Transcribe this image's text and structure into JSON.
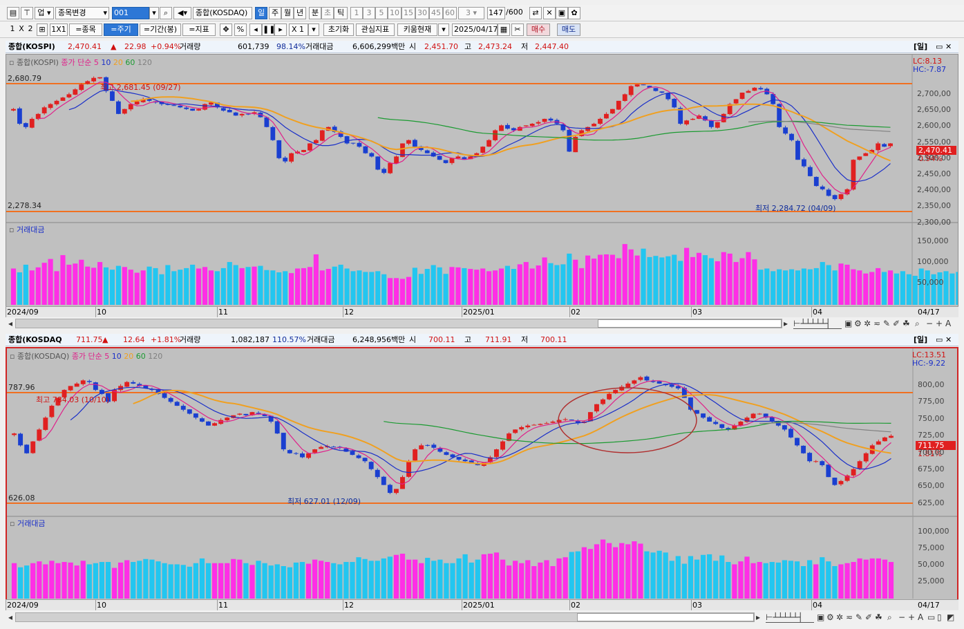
{
  "toolbar1": {
    "market_select": "업",
    "change_symbol": "종목변경",
    "code": "001",
    "symbol_name": "종합(KOSDAQ)",
    "periods": [
      "일",
      "주",
      "월",
      "년",
      "분",
      "초",
      "틱"
    ],
    "selected_period": "일",
    "intervals": [
      "1",
      "3",
      "5",
      "10",
      "15",
      "30",
      "45",
      "60"
    ],
    "count_select": "3",
    "record_count": "147",
    "record_total": "/600"
  },
  "toolbar2": {
    "layout_1": "1",
    "layout_x": "X",
    "layout_2": "2",
    "grid_label": "1X1",
    "btn_symbol": "=종목",
    "btn_period": "=주기",
    "btn_range": "=기간(봉)",
    "btn_indicator": "=지표",
    "pct": "%",
    "mult": "X 1",
    "reset": "초기화",
    "fav": "관심지표",
    "kiwoom": "키움현재",
    "date": "2025/04/17",
    "buy": "매수",
    "sell": "매도"
  },
  "pane1": {
    "info": {
      "name": "종합(KOSPI)",
      "price": "2,470.41",
      "arrow": "▲",
      "change": "22.98",
      "pct": "+0.94%",
      "vol_label": "거래량",
      "vol": "601,739",
      "vol_pct": "98.14%",
      "amt_label": "거래대금",
      "amt": "6,606,299백만",
      "open_label": "시",
      "open": "2,451.70",
      "high_label": "고",
      "high": "2,473.24",
      "low_label": "저",
      "low": "2,447.40"
    },
    "period_tag": "[일]",
    "legend": {
      "name": "종합(KOSPI)",
      "ma_label": "종가 단순",
      "ma5": "5",
      "ma10": "10",
      "ma20": "20",
      "ma60": "60",
      "ma120": "120"
    },
    "lc": "LC:8.13",
    "hc": "HC:-7.87",
    "hi_line": "2,680.79",
    "lo_line": "2,278.34",
    "hi_note": "최고 2,681.45 (09/27)",
    "lo_note": "최저 2,284.72 (04/09)",
    "price_badge": "2,470.41",
    "pct_badge": "0.94%",
    "y_ticks": [
      "2,700,00",
      "2,650,00",
      "2,600,00",
      "2,550,00",
      "2,500,00",
      "2,450,00",
      "2,400,00",
      "2,350,00",
      "2,300,00"
    ],
    "vol_title": "거래대금",
    "vol_ticks": [
      "150,000",
      "100,000",
      "50,000"
    ],
    "dates": [
      "2024/09",
      "10",
      "11",
      "12",
      "2025/01",
      "02",
      "03",
      "04"
    ],
    "last_date": "04/17"
  },
  "pane2": {
    "info": {
      "name": "종합(KOSDAQ",
      "price": "711.75",
      "arrow": "▲",
      "change": "12.64",
      "pct": "+1.81%",
      "vol_label": "거래량",
      "vol": "1,082,187",
      "vol_pct": "110.57%",
      "amt_label": "거래대금",
      "amt": "6,248,956백만",
      "open_label": "시",
      "open": "700.11",
      "high_label": "고",
      "high": "711.91",
      "low_label": "저",
      "low": "700.11"
    },
    "period_tag": "[일]",
    "legend": {
      "name": "종합(KOSDAQ)",
      "ma_label": "종가 단순",
      "ma5": "5",
      "ma10": "10",
      "ma20": "20",
      "ma60": "60",
      "ma120": "120"
    },
    "lc": "LC:13.51",
    "hc": "HC:-9.22",
    "hi_line": "787.96",
    "lo_line": "626.08",
    "hi_note": "최고 784.03 (10/10)",
    "lo_note": "최저 627.01 (12/09)",
    "price_badge": "711.75",
    "pct_badge": "1.81%",
    "y_ticks": [
      "800,00",
      "775,00",
      "750,00",
      "725,00",
      "700,00",
      "675,00",
      "650,00",
      "625,00"
    ],
    "vol_title": "거래대금",
    "vol_ticks": [
      "100,000",
      "75,000",
      "50,000",
      "25,000"
    ],
    "dates": [
      "2024/09",
      "10",
      "11",
      "12",
      "2025/01",
      "02",
      "03",
      "04"
    ],
    "last_date": "04/17"
  },
  "colors": {
    "up": "#e02020",
    "down": "#1a3fd0",
    "vol_up": "#ff2ee6",
    "vol_down": "#22c6f0",
    "ma5": "#e0208a",
    "ma10": "#1a2fc8",
    "ma20": "#f0a020",
    "ma60": "#1a9a30",
    "ma120": "#808080",
    "hline": "#f07020"
  },
  "chart_data": [
    {
      "type": "candlestick",
      "title": "종합(KOSPI)",
      "y_range": [
        2260,
        2720
      ],
      "close": [
        2575,
        2530,
        2520,
        2545,
        2560,
        2580,
        2590,
        2600,
        2610,
        2620,
        2635,
        2650,
        2660,
        2670,
        2672,
        2630,
        2600,
        2560,
        2575,
        2590,
        2598,
        2605,
        2600,
        2595,
        2590,
        2588,
        2585,
        2580,
        2575,
        2570,
        2575,
        2590,
        2595,
        2580,
        2570,
        2565,
        2555,
        2560,
        2560,
        2565,
        2550,
        2520,
        2480,
        2425,
        2415,
        2440,
        2445,
        2450,
        2470,
        2480,
        2510,
        2520,
        2505,
        2490,
        2470,
        2470,
        2460,
        2440,
        2430,
        2390,
        2380,
        2410,
        2430,
        2470,
        2480,
        2460,
        2450,
        2440,
        2430,
        2420,
        2410,
        2425,
        2430,
        2420,
        2430,
        2440,
        2460,
        2480,
        2510,
        2525,
        2515,
        2510,
        2520,
        2525,
        2530,
        2535,
        2545,
        2540,
        2530,
        2510,
        2445,
        2490,
        2510,
        2520,
        2530,
        2545,
        2560,
        2575,
        2600,
        2620,
        2645,
        2650,
        2648,
        2640,
        2630,
        2625,
        2605,
        2580,
        2530,
        2540,
        2545,
        2555,
        2540,
        2520,
        2535,
        2560,
        2590,
        2605,
        2625,
        2630,
        2640,
        2635,
        2620,
        2590,
        2520,
        2500,
        2480,
        2420,
        2400,
        2370,
        2340,
        2330,
        2310,
        2300,
        2315,
        2330,
        2420,
        2430,
        2440,
        2450,
        2470,
        2460,
        2470
      ],
      "volume": [
        95,
        85,
        105,
        90,
        98,
        110,
        120,
        88,
        130,
        105,
        108,
        118,
        100,
        97,
        112,
        98,
        92,
        102,
        99,
        92,
        84,
        90,
        100,
        96,
        80,
        104,
        88,
        92,
        96,
        105,
        95,
        99,
        90,
        88,
        96,
        112,
        104,
        96,
        99,
        100,
        102,
        91,
        90,
        85,
        88,
        83,
        95,
        96,
        99,
        132,
        90,
        94,
        100,
        105,
        95,
        88,
        90,
        86,
        86,
        88,
        80,
        70,
        70,
        68,
        73,
        97,
        81,
        94,
        104,
        98,
        81,
        99,
        98,
        96,
        94,
        92,
        95,
        88,
        90,
        95,
        102,
        94,
        106,
        112,
        95,
        103,
        124,
        109,
        104,
        106,
        134,
        118,
        96,
        129,
        121,
        131,
        132,
        131,
        122,
        159,
        145,
        129,
        147,
        125,
        128,
        124,
        127,
        131,
        115,
        149,
        125,
        136,
        130,
        122,
        114,
        138,
        134,
        112,
        122,
        138,
        119,
        92,
        95,
        88,
        93,
        90,
        93,
        90,
        95,
        93,
        96,
        112,
        104,
        90,
        108,
        105,
        93,
        90,
        82,
        86,
        96,
        86,
        90,
        82,
        88,
        80,
        76,
        95,
        90,
        80,
        85,
        88,
        82,
        86,
        84,
        86,
        92
      ]
    },
    {
      "type": "candlestick",
      "title": "종합(KOSDAQ)",
      "y_range": [
        620,
        812
      ],
      "close": [
        715,
        700,
        690,
        705,
        720,
        735,
        750,
        760,
        770,
        775,
        778,
        782,
        780,
        770,
        765,
        755,
        770,
        775,
        780,
        778,
        775,
        772,
        770,
        765,
        760,
        755,
        750,
        745,
        740,
        735,
        730,
        725,
        728,
        732,
        735,
        738,
        740,
        738,
        742,
        740,
        737,
        730,
        715,
        695,
        690,
        690,
        685,
        690,
        695,
        698,
        699,
        698,
        697,
        692,
        688,
        684,
        680,
        670,
        660,
        650,
        640,
        645,
        660,
        680,
        695,
        700,
        700,
        697,
        692,
        688,
        685,
        682,
        680,
        677,
        675,
        678,
        685,
        695,
        705,
        715,
        720,
        723,
        725,
        726,
        727,
        728,
        730,
        732,
        733,
        732,
        728,
        730,
        742,
        752,
        758,
        765,
        770,
        774,
        778,
        782,
        786,
        782,
        780,
        778,
        776,
        774,
        772,
        760,
        745,
        740,
        735,
        730,
        727,
        722,
        720,
        725,
        730,
        735,
        740,
        740,
        735,
        730,
        725,
        720,
        710,
        700,
        690,
        680,
        680,
        675,
        660,
        650,
        655,
        662,
        670,
        680,
        690,
        700,
        705,
        710,
        712
      ],
      "volume": [
        60,
        53,
        56,
        60,
        63,
        58,
        64,
        60,
        62,
        61,
        56,
        64,
        58,
        60,
        62,
        62,
        52,
        61,
        65,
        62,
        64,
        67,
        66,
        63,
        60,
        58,
        58,
        57,
        54,
        60,
        68,
        60,
        60,
        60,
        60,
        67,
        66,
        60,
        57,
        64,
        60,
        56,
        58,
        55,
        53,
        61,
        62,
        59,
        66,
        64,
        62,
        60,
        58,
        62,
        62,
        70,
        67,
        64,
        64,
        68,
        71,
        74,
        76,
        66,
        66,
        60,
        69,
        64,
        66,
        60,
        60,
        68,
        75,
        61,
        66,
        75,
        76,
        78,
        66,
        56,
        64,
        60,
        65,
        55,
        61,
        65,
        55,
        68,
        70,
        79,
        80,
        87,
        84,
        92,
        100,
        94,
        87,
        94,
        92,
        97,
        93,
        80,
        78,
        81,
        78,
        64,
        72,
        59,
        72,
        66,
        74,
        75,
        64,
        73,
        62,
        58,
        63,
        71,
        60,
        62,
        60,
        62,
        61,
        65,
        64,
        63,
        55,
        65,
        58,
        70,
        63,
        55,
        58,
        60,
        62,
        68,
        66,
        68,
        68,
        66,
        62
      ]
    }
  ]
}
